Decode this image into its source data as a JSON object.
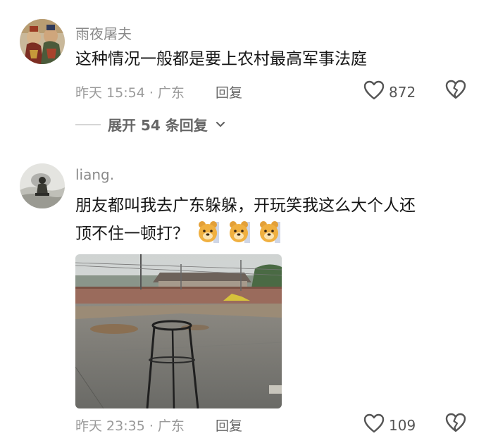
{
  "comments": [
    {
      "username": "雨夜屠夫",
      "text": "这种情况一般都是要上农村最高军事法庭",
      "time_location": "昨天 15:54 · 广东",
      "reply_label": "回复",
      "likes": "872",
      "expand_label": "展开 54 条回复"
    },
    {
      "username": "liang.",
      "text_line1": "朋友都叫我去广东躲躲，开玩笑我这么大个人还",
      "text_line2": "顶不住一顿打？",
      "time_location": "昨天 23:35 · 广东",
      "reply_label": "回复",
      "likes": "109"
    }
  ],
  "icons": {
    "like": "heart-outline-icon",
    "dislike": "broken-heart-icon",
    "expand": "chevron-down-icon",
    "emoji": "bear-emoji-icon"
  },
  "colors": {
    "text": "#161616",
    "secondary": "#8a8a8a",
    "icon": "#555555"
  }
}
